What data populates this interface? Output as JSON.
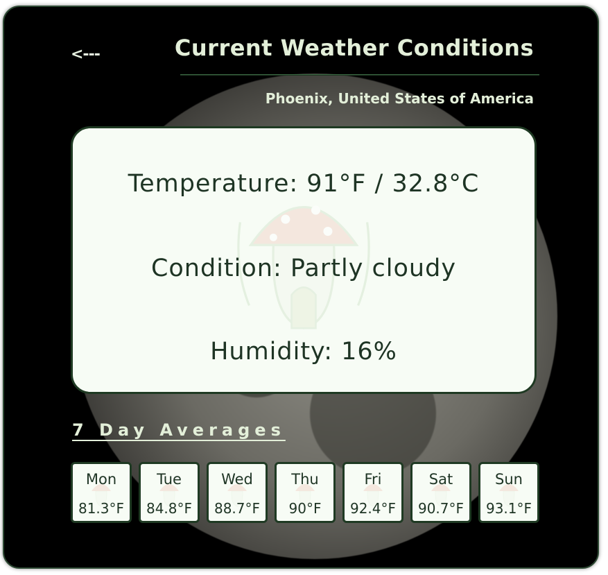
{
  "header": {
    "back_label": "<---",
    "title": "Current Weather Conditions",
    "location": "Phoenix, United States of America"
  },
  "current": {
    "temperature": "Temperature: 91°F / 32.8°C",
    "condition": "Condition: Partly cloudy",
    "humidity": "Humidity: 16%"
  },
  "averages": {
    "heading": "7 Day Averages",
    "days": [
      {
        "name": "Mon",
        "temp": "81.3°F"
      },
      {
        "name": "Tue",
        "temp": "84.8°F"
      },
      {
        "name": "Wed",
        "temp": "88.7°F"
      },
      {
        "name": "Thu",
        "temp": "90°F"
      },
      {
        "name": "Fri",
        "temp": "92.4°F"
      },
      {
        "name": "Sat",
        "temp": "90.7°F"
      },
      {
        "name": "Sun",
        "temp": "93.1°F"
      }
    ]
  },
  "colors": {
    "background": "#000000",
    "card": "#f7fcf5",
    "card_border": "#1f3a23",
    "text_light": "#e3efd9",
    "text_dark": "#1e3424"
  },
  "icons": {
    "back": "back-arrow-icon",
    "watermark": "mushroom-house-icon"
  }
}
